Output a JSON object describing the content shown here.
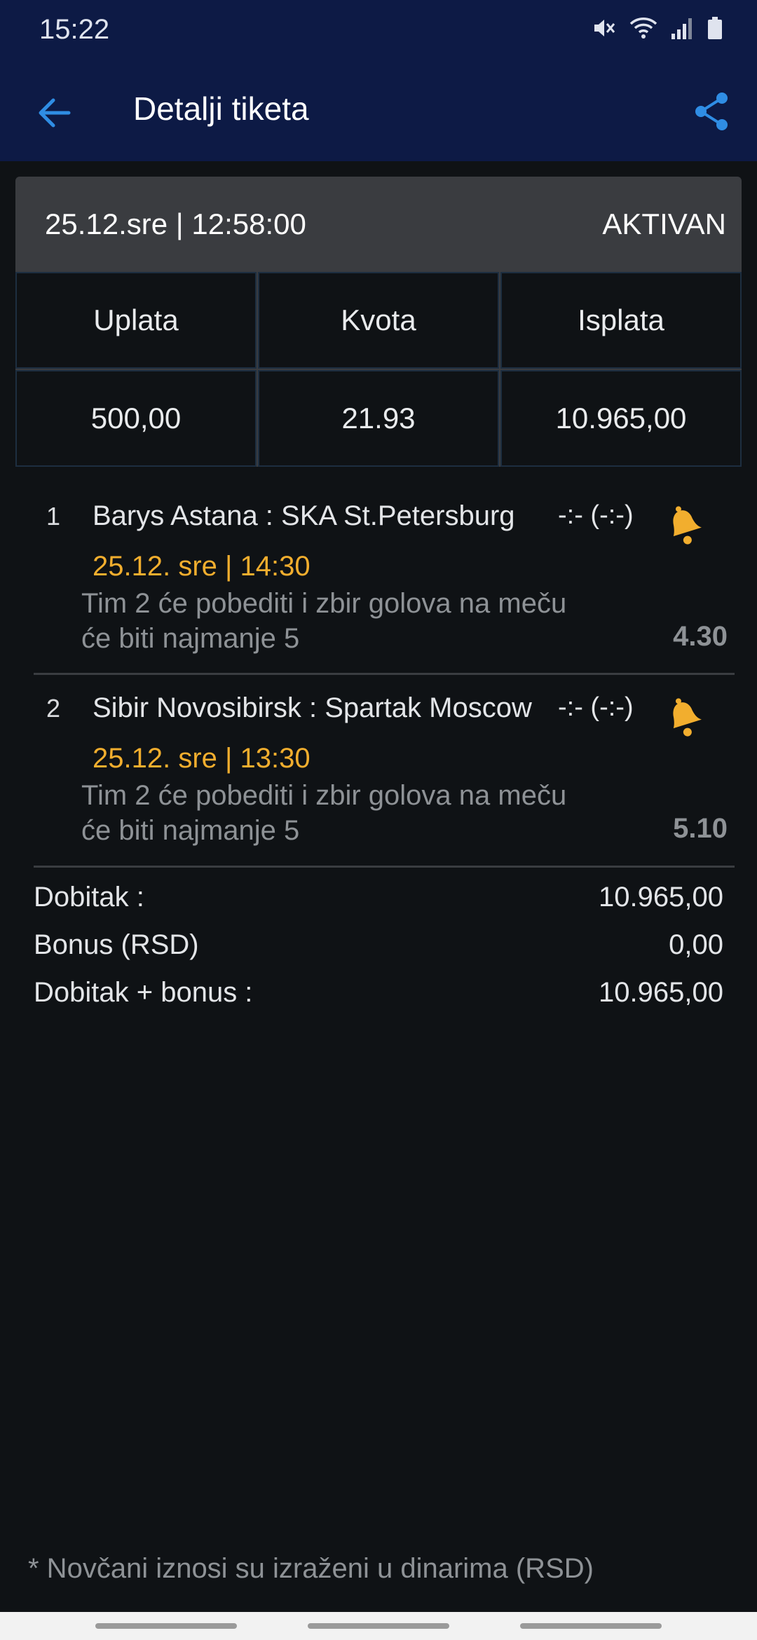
{
  "status_bar": {
    "time": "15:22",
    "icons": [
      "mute-icon",
      "wifi-icon",
      "signal-icon",
      "battery-icon"
    ]
  },
  "app_bar": {
    "title": "Detalji tiketa",
    "back_icon": "arrow-left-icon",
    "share_icon": "share-icon",
    "accent_color": "#2f8de4"
  },
  "ticket": {
    "date": "25.12.sre | 12:58:00",
    "status": "AKTIVAN",
    "headers": {
      "payment": "Uplata",
      "odds": "Kvota",
      "payout": "Isplata"
    },
    "values": {
      "payment": "500,00",
      "odds": "21.93",
      "payout": "10.965,00"
    }
  },
  "matches": [
    {
      "num": "1",
      "teams": "Barys Astana : SKA St.Petersburg",
      "score": "-:- (-:-)",
      "time": "25.12. sre | 14:30",
      "desc_line1": "Tim 2 će pobediti i zbir golova na meču",
      "desc_line2": "će biti najmanje 5",
      "odd": "4.30",
      "icon": "bell-icon"
    },
    {
      "num": "2",
      "teams": "Sibir Novosibirsk : Spartak Moscow",
      "score": "-:- (-:-)",
      "time": "25.12. sre | 13:30",
      "desc_line1": "Tim 2 će pobediti i zbir golova na meču",
      "desc_line2": "će biti najmanje 5",
      "odd": "5.10",
      "icon": "bell-icon"
    }
  ],
  "summary": {
    "win_label": "Dobitak :",
    "win_value": "10.965,00",
    "bonus_label": "Bonus (RSD)",
    "bonus_value": "0,00",
    "total_label": "Dobitak + bonus :",
    "total_value": "10.965,00"
  },
  "footnote": "* Novčani iznosi su izraženi u dinarima (RSD)",
  "colors": {
    "header_bg": "#0d1a45",
    "highlight": "#f2ae2e",
    "muted": "#8e9296"
  }
}
